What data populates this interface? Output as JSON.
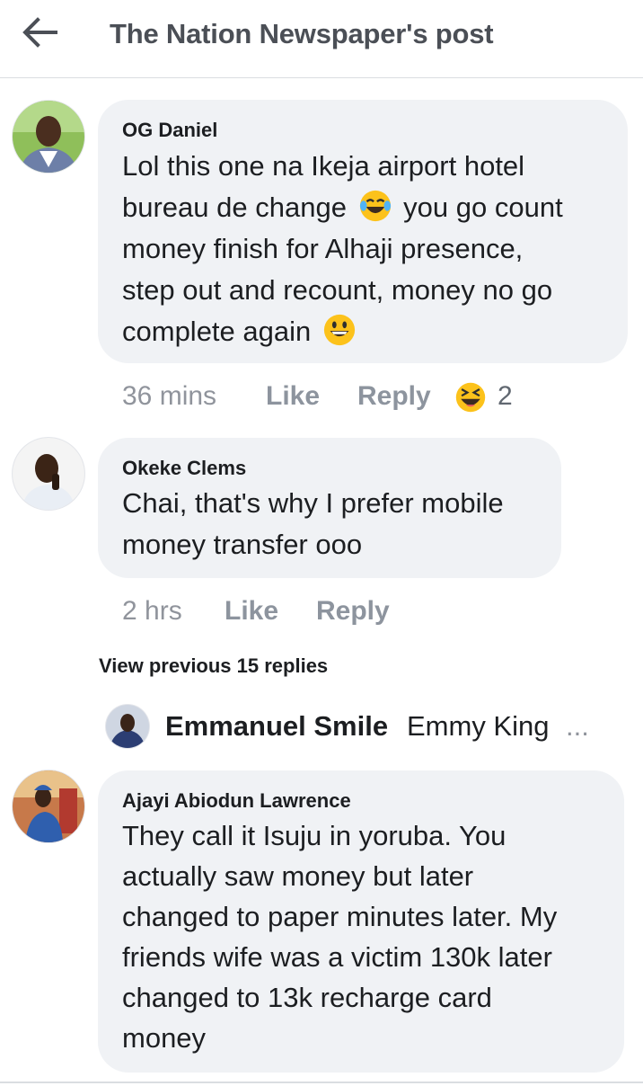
{
  "header": {
    "title": "The Nation Newspaper's post",
    "back_icon": "arrow-left-icon"
  },
  "comments": [
    {
      "author": "OG Daniel",
      "lines": [
        {
          "before": "Lol this one na Ikeja airport hotel",
          "emoji": null,
          "after": ""
        },
        {
          "before": "bureau de change ",
          "emoji": "face-with-tears-of-joy",
          "after": " you go count"
        },
        {
          "before": "money finish for Alhaji presence,",
          "emoji": null,
          "after": ""
        },
        {
          "before": "step out and recount, money no go",
          "emoji": null,
          "after": ""
        },
        {
          "before": "complete again ",
          "emoji": "grinning-face",
          "after": ""
        }
      ],
      "time": "36 mins",
      "like_label": "Like",
      "reply_label": "Reply",
      "reaction_icon": "laughing-squinting-face",
      "reaction_count": "2"
    },
    {
      "author": "Okeke Clems",
      "lines": [
        {
          "before": "Chai, that's why I prefer mobile",
          "emoji": null,
          "after": ""
        },
        {
          "before": "money transfer ooo",
          "emoji": null,
          "after": ""
        }
      ],
      "time": "2 hrs",
      "like_label": "Like",
      "reply_label": "Reply"
    },
    {
      "author": "Ajayi Abiodun Lawrence",
      "lines": [
        {
          "before": "They call it Isuju in yoruba. You",
          "emoji": null,
          "after": ""
        },
        {
          "before": "actually saw money but later",
          "emoji": null,
          "after": ""
        },
        {
          "before": "changed to paper minutes later. My",
          "emoji": null,
          "after": ""
        },
        {
          "before": "friends wife was a victim 130k later",
          "emoji": null,
          "after": ""
        },
        {
          "before": "changed to 13k recharge card",
          "emoji": null,
          "after": ""
        },
        {
          "before": "money",
          "emoji": null,
          "after": ""
        }
      ]
    }
  ],
  "view_previous": "View previous 15 replies",
  "reply_preview": {
    "name": "Emmanuel Smile",
    "text": "Emmy King",
    "ellipsis": "..."
  },
  "colors": {
    "bubble": "#f0f2f5",
    "meta_text": "#90949c",
    "title_text": "#4b4f56"
  }
}
